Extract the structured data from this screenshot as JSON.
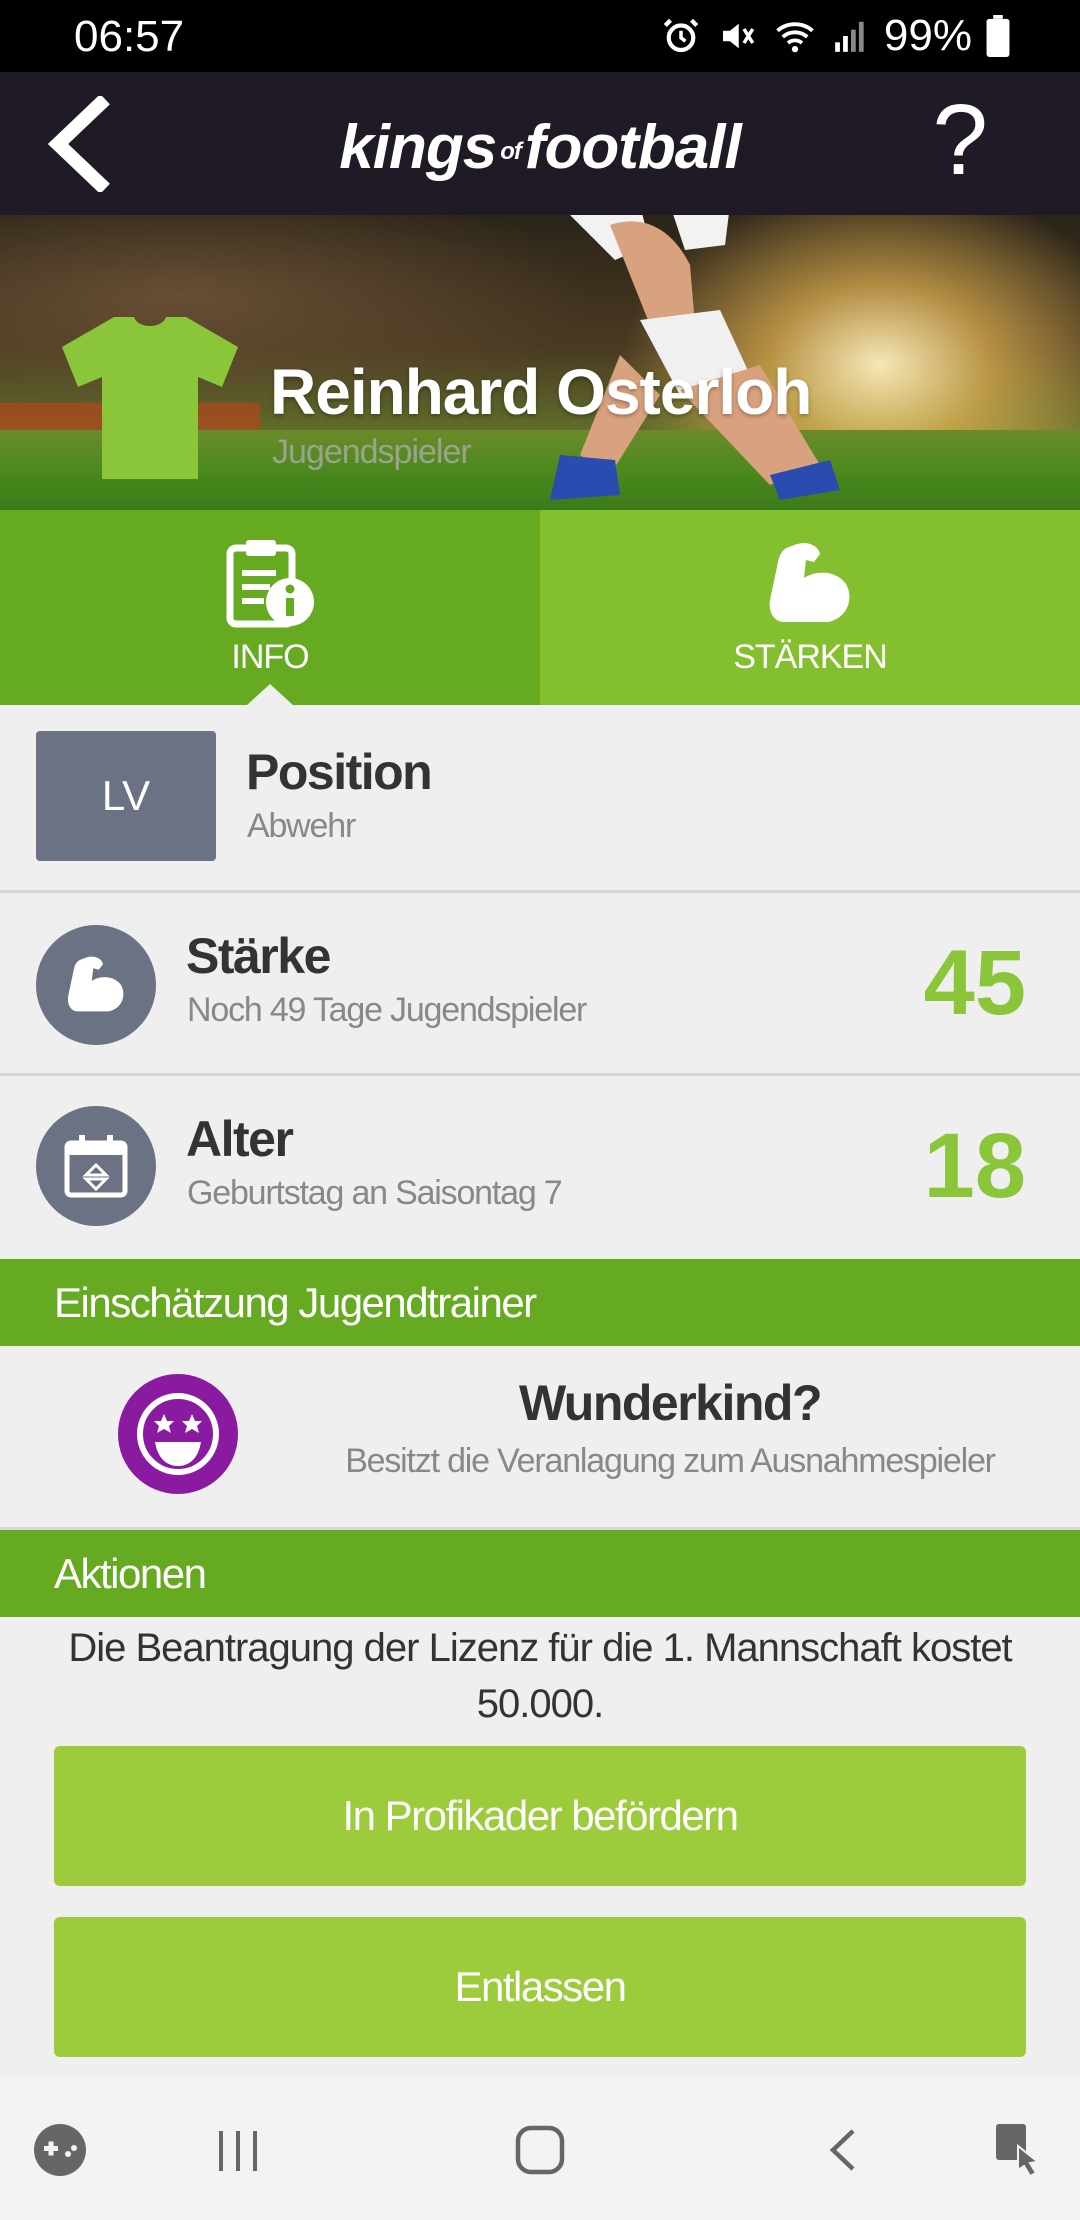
{
  "status_bar": {
    "time": "06:57",
    "battery": "99%"
  },
  "header": {
    "logo_main_1": "kings",
    "logo_of": "of",
    "logo_main_2": "football",
    "help": "?"
  },
  "player": {
    "name": "Reinhard Osterloh",
    "role": "Jugendspieler",
    "shirt_color": "#8bc53a"
  },
  "tabs": [
    {
      "label": "INFO",
      "icon": "clipboard-info-icon"
    },
    {
      "label": "STÄRKEN",
      "icon": "muscle-arm-icon"
    }
  ],
  "position": {
    "code": "LV",
    "title": "Position",
    "value": "Abwehr"
  },
  "strength": {
    "title": "Stärke",
    "subtitle": "Noch 49 Tage Jugendspieler",
    "value": "45"
  },
  "age": {
    "title": "Alter",
    "subtitle": "Geburtstag an Saisontag 7",
    "value": "18"
  },
  "assessment": {
    "header": "Einschätzung Jugendtrainer",
    "title": "Wunderkind?",
    "subtitle": "Besitzt die Veranlagung zum Ausnahmespieler",
    "icon": "star-eyes-face-icon"
  },
  "actions": {
    "header": "Aktionen",
    "license_text": "Die Beantragung der Lizenz für die 1. Mannschaft kostet 50.000.",
    "promote_label": "In Profikader befördern",
    "dismiss_label": "Entlassen"
  },
  "colors": {
    "accent": "#66aa22",
    "light_accent": "#9ccb3b",
    "number": "#8bc53a",
    "header_bg": "#201a26",
    "icon_bg": "#6b7284",
    "badge_purple": "#8a1aa0"
  }
}
